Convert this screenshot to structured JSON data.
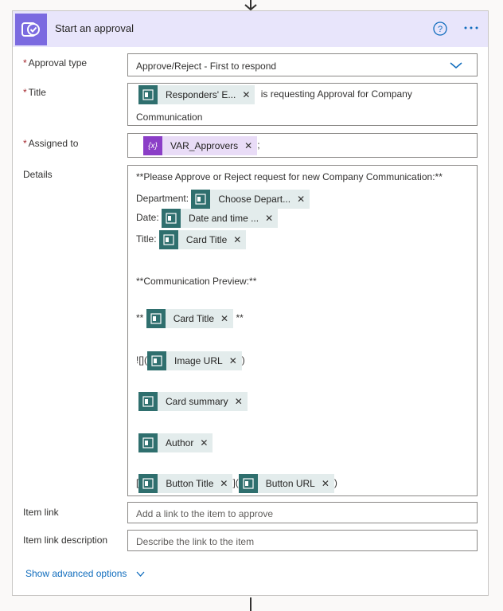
{
  "card": {
    "title": "Start an approval",
    "header_color": "#e8e5fb",
    "accent": "#0f6cbd",
    "icons": {
      "app": "approval-check-icon",
      "help": "help-circle-icon",
      "more": "more-ellipsis-icon"
    }
  },
  "fields": {
    "approval_type": {
      "label": "Approval type",
      "required_mark": "*",
      "value": "Approve/Reject - First to respond"
    },
    "title": {
      "label": "Title",
      "required_mark": "*",
      "token": "Responders' E...",
      "text_after": "is requesting Approval for Company",
      "text_line2": "Communication"
    },
    "assigned_to": {
      "label": "Assigned to",
      "required_mark": "*",
      "token": "VAR_Approvers",
      "var_symbol": "{x}",
      "suffix": ";"
    },
    "details": {
      "label": "Details",
      "line1": "**Please Approve or Reject request for new Company Communication:**",
      "dept_label": "Department:",
      "dept_token": "Choose Depart...",
      "date_label": "Date:",
      "date_token": "Date and time ...",
      "title_label": "Title:",
      "title_token": "Card Title",
      "preview": "**Communication Preview:**",
      "stars": "**",
      "card_title_token": "Card Title",
      "image_prefix": "![](",
      "image_token": "Image URL",
      "close_paren": ")",
      "summary_token": "Card summary",
      "author_token": "Author",
      "open_bracket": "[",
      "button_title_token": "Button Title",
      "bracket_paren": "](",
      "button_url_token": "Button URL"
    },
    "item_link": {
      "label": "Item link",
      "placeholder": "Add a link to the item to approve"
    },
    "item_link_desc": {
      "label": "Item link description",
      "placeholder": "Describe the link to the item"
    }
  },
  "advanced": {
    "label": "Show advanced options"
  }
}
